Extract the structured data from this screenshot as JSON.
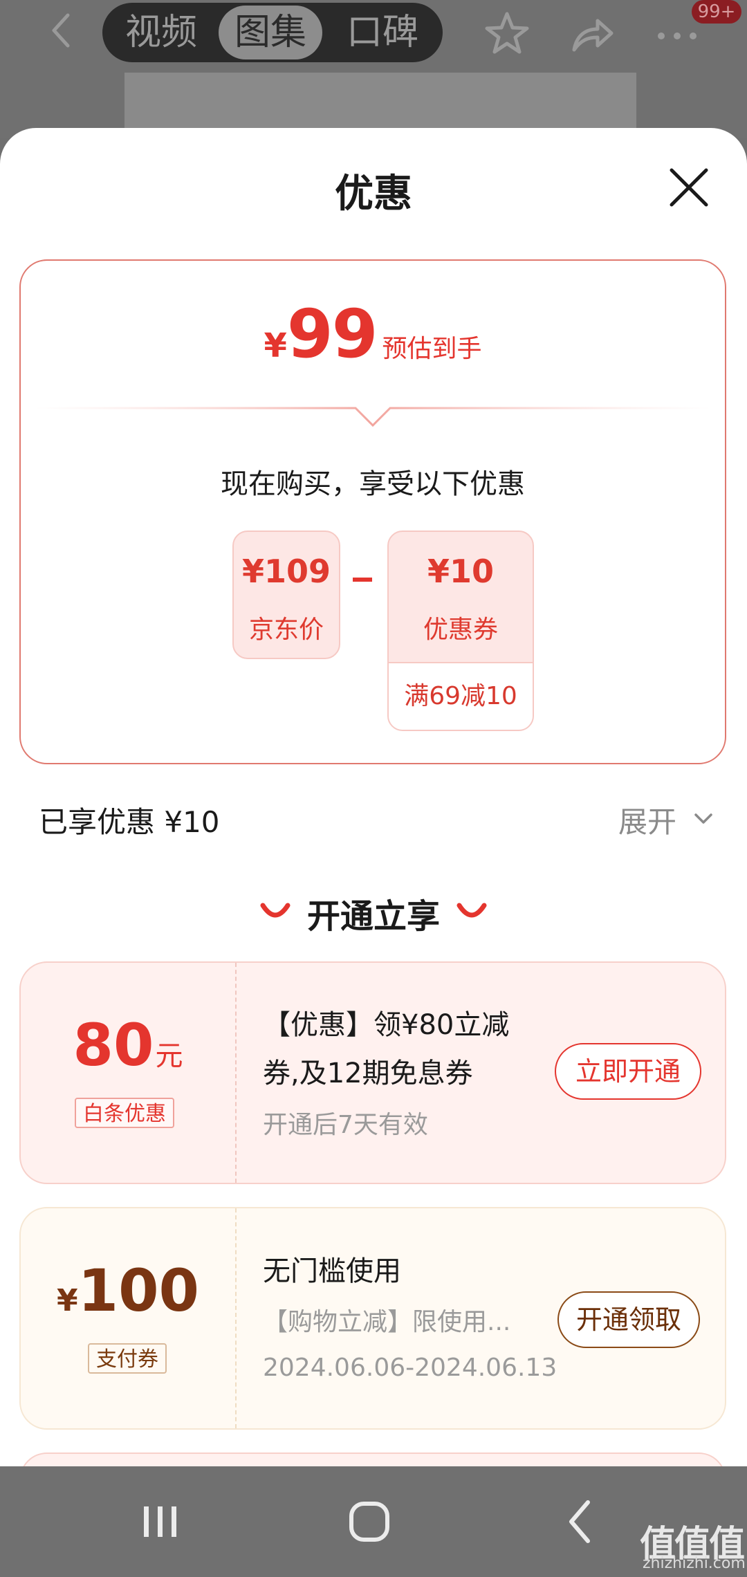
{
  "topbar": {
    "tabs": [
      "视频",
      "图集",
      "口碑"
    ],
    "active_tab": "图集",
    "badge": "99+"
  },
  "sheet": {
    "title": "优惠",
    "estimate": {
      "currency": "¥",
      "amount": "99",
      "label": "预估到手"
    },
    "buy_now_text": "现在购买，享受以下优惠",
    "jd_box": {
      "price": "¥109",
      "label": "京东价"
    },
    "coupon_box": {
      "price": "¥10",
      "label": "优惠券",
      "condition": "满69减10"
    },
    "enjoyed_text": "已享优惠 ¥10",
    "expand_label": "展开",
    "section_title": "开通立享"
  },
  "offers": [
    {
      "amount": "80",
      "unit": "元",
      "tag": "白条优惠",
      "title": "【优惠】领¥80立减券,及12期免息券",
      "sub": "开通后7天有效",
      "button": "立即开通"
    },
    {
      "currency": "¥",
      "amount": "100",
      "tag": "支付券",
      "title": "无门槛使用",
      "sub": "【购物立减】限使用...",
      "date": "2024.06.06-2024.06.13",
      "button": "开通领取"
    }
  ],
  "watermark": {
    "big": "值值值",
    "small": "zhizhizhi.com"
  },
  "colors": {
    "accent_red": "#e4352e",
    "gold_brown": "#7a3512"
  }
}
